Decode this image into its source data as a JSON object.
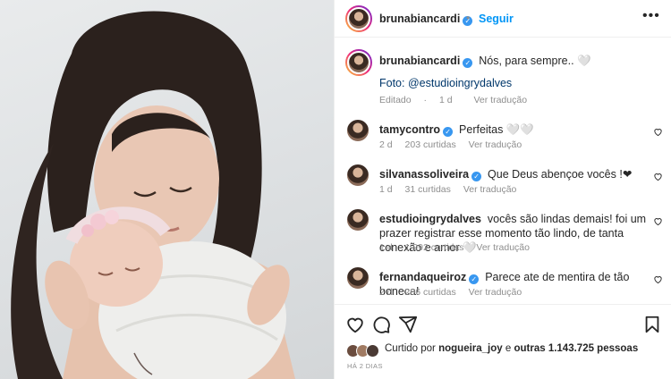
{
  "header": {
    "username": "brunabiancardi",
    "separator": "•",
    "follow_label": "Seguir",
    "more_icon": "more-horizontal-icon"
  },
  "caption": {
    "username": "brunabiancardi",
    "text": "Nós, para sempre.. 🤍",
    "photo_credit": "Foto: @estudioingrydalves",
    "edited_label": "Editado",
    "separator": "·",
    "time": "1 d",
    "see_translation": "Ver tradução"
  },
  "comments": [
    {
      "username": "tamycontro",
      "verified": true,
      "text": "Perfeitas 🤍🤍",
      "time": "2 d",
      "likes": "203 curtidas",
      "translate": "Ver tradução"
    },
    {
      "username": "silvanassoliveira",
      "verified": true,
      "text": "Que Deus abençoe vocês !❤",
      "time": "1 d",
      "likes": "31 curtidas",
      "translate": "Ver tradução"
    },
    {
      "username": "estudioingrydalves",
      "verified": false,
      "text": "vocês são lindas demais! foi um prazer registrar esse momento tão lindo, de tanta conexão e amor 🤍",
      "time": "1 d",
      "likes": "1.992 curtidas",
      "translate": "Ver tradução"
    },
    {
      "username": "fernandaqueiroz",
      "verified": true,
      "text": "Parece ate de mentira de tão boneca!",
      "time": "2 d",
      "likes": "206 curtidas",
      "translate": "Ver tradução"
    }
  ],
  "actions": {
    "like_icon": "heart-icon",
    "comment_icon": "comment-icon",
    "share_icon": "share-icon",
    "save_icon": "bookmark-icon"
  },
  "likes_summary": {
    "prefix": "Curtido por",
    "user": "nogueira_joy",
    "connector": "e",
    "others": "outras 1.143.725 pessoas"
  },
  "posted_ago": "HÁ 2 DIAS",
  "colors": {
    "accent_blue": "#0095f6",
    "verified_blue": "#3897f0",
    "muted": "#8e8e8e",
    "text": "#262626"
  }
}
